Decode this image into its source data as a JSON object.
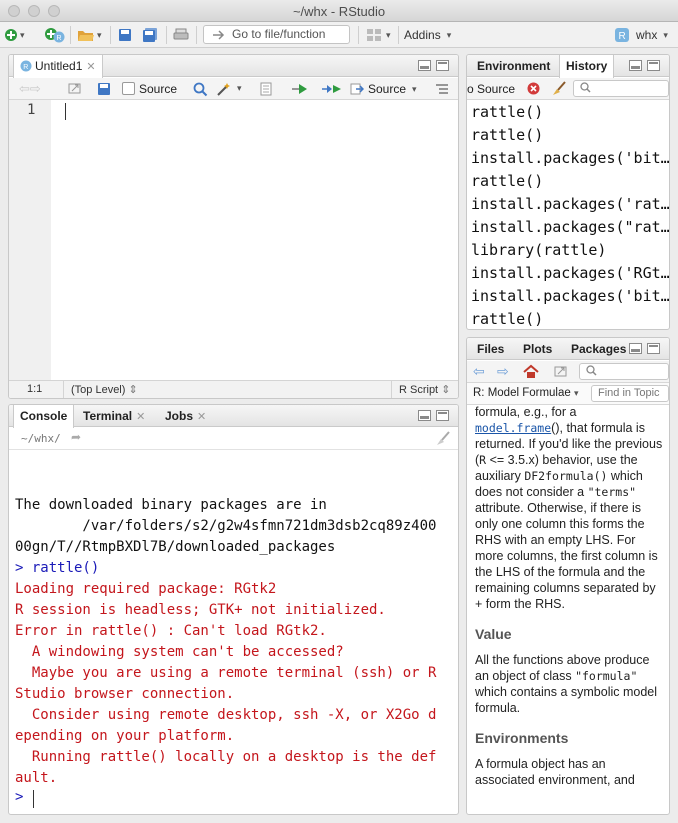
{
  "window": {
    "title": "~/whx - RStudio"
  },
  "toolbar": {
    "goto_placeholder": "Go to file/function",
    "addins_label": "Addins",
    "project_label": "whx"
  },
  "editor": {
    "tab_label": "Untitled1",
    "source_on_save_label": "Source",
    "source_button_label": "Source",
    "line_number": "1",
    "cursor_pos": "1:1",
    "scope": "(Top Level)",
    "file_type": "R Script"
  },
  "console": {
    "tabs": [
      "Console",
      "Terminal",
      "Jobs"
    ],
    "working_dir": "~/whx/",
    "lines": [
      {
        "text": "The downloaded binary packages are in",
        "kind": "out"
      },
      {
        "text": "        /var/folders/s2/g2w4sfmn721dm3dsb2cq89z400",
        "kind": "out"
      },
      {
        "text": "00gn/T//RtmpBXDl7B/downloaded_packages",
        "kind": "out"
      },
      {
        "text": "> rattle()",
        "kind": "cmd"
      },
      {
        "text": "Loading required package: RGtk2",
        "kind": "err"
      },
      {
        "text": "R session is headless; GTK+ not initialized.",
        "kind": "err"
      },
      {
        "text": "Error in rattle() : Can't load RGtk2.",
        "kind": "err"
      },
      {
        "text": "  A windowing system can't be accessed?",
        "kind": "err"
      },
      {
        "text": "  Maybe you are using a remote terminal (ssh) or R",
        "kind": "err"
      },
      {
        "text": "Studio browser connection.",
        "kind": "err"
      },
      {
        "text": "  Consider using remote desktop, ssh -X, or X2Go d",
        "kind": "err"
      },
      {
        "text": "epending on your platform.",
        "kind": "err"
      },
      {
        "text": "  Running rattle() locally on a desktop is the def",
        "kind": "err"
      },
      {
        "text": "ault.",
        "kind": "err"
      }
    ],
    "prompt": ">"
  },
  "env": {
    "tabs": [
      "Environment",
      "History"
    ],
    "to_source_label": "o Source",
    "history": [
      "rattle()",
      "rattle()",
      "install.packages('bit…",
      "rattle()",
      "install.packages('rat…",
      "install.packages(\"rat…",
      "library(rattle)",
      "install.packages('RGt…",
      "install.packages('bit…",
      "rattle()"
    ]
  },
  "files": {
    "tabs": [
      "Files",
      "Plots",
      "Packages"
    ],
    "help_topic": "R: Model Formulae",
    "find_placeholder": "Find in Topic",
    "help": {
      "p1_a": "formula, e.g., for a ",
      "p1_link": "model.frame",
      "p1_b": "(), that formula is returned. If you'd like the previous (",
      "p1_r": "R",
      "p1_c": " <= 3.5.x) behavior, use the auxiliary ",
      "p1_code": "DF2formula()",
      "p1_d": " which does not consider a ",
      "p1_code2": "\"terms\"",
      "p1_e": " attribute. Otherwise, if there is only one column this forms the RHS with an empty LHS. For more columns, the first column is the LHS of the formula and the remaining columns separated by + form the RHS.",
      "h_value": "Value",
      "p2_a": "All the functions above produce an object of class ",
      "p2_code": "\"formula\"",
      "p2_b": " which contains a symbolic model formula.",
      "h_env": "Environments",
      "p3": "A formula object has an associated environment, and"
    }
  },
  "colors": {
    "console_error": "#c4161c",
    "console_command": "#1a1ab8",
    "link": "#1a55a8"
  }
}
